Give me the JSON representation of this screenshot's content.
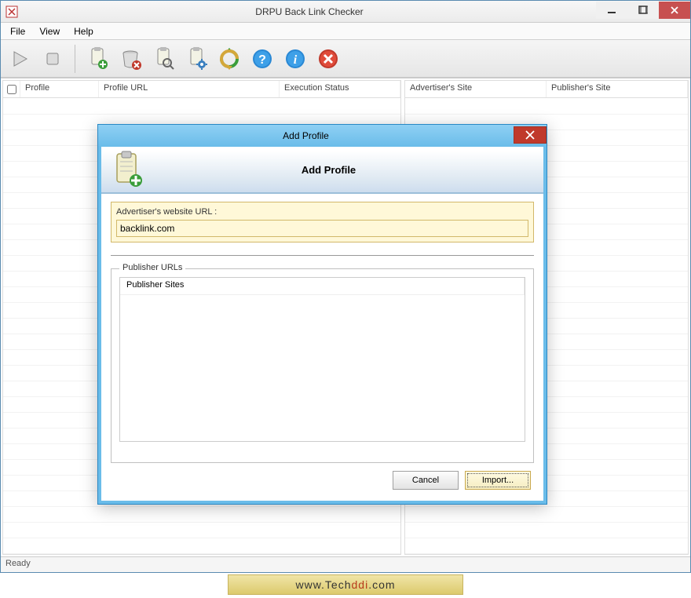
{
  "window": {
    "title": "DRPU Back Link Checker",
    "status": "Ready"
  },
  "menubar": [
    "File",
    "View",
    "Help"
  ],
  "columns_left": [
    "Profile",
    "Profile URL",
    "Execution Status"
  ],
  "columns_right": [
    "Advertiser's Site",
    "Publisher's Site"
  ],
  "dialog": {
    "title": "Add Profile",
    "banner_title": "Add Profile",
    "adv_label": "Advertiser's website URL :",
    "adv_value": "backlink.com",
    "pub_legend": "Publisher URLs",
    "pub_header": "Publisher Sites",
    "buttons": {
      "cancel": "Cancel",
      "import": "Import..."
    }
  },
  "watermark": {
    "prefix": "www.Tech",
    "accent": "ddi",
    "suffix": ".com"
  }
}
